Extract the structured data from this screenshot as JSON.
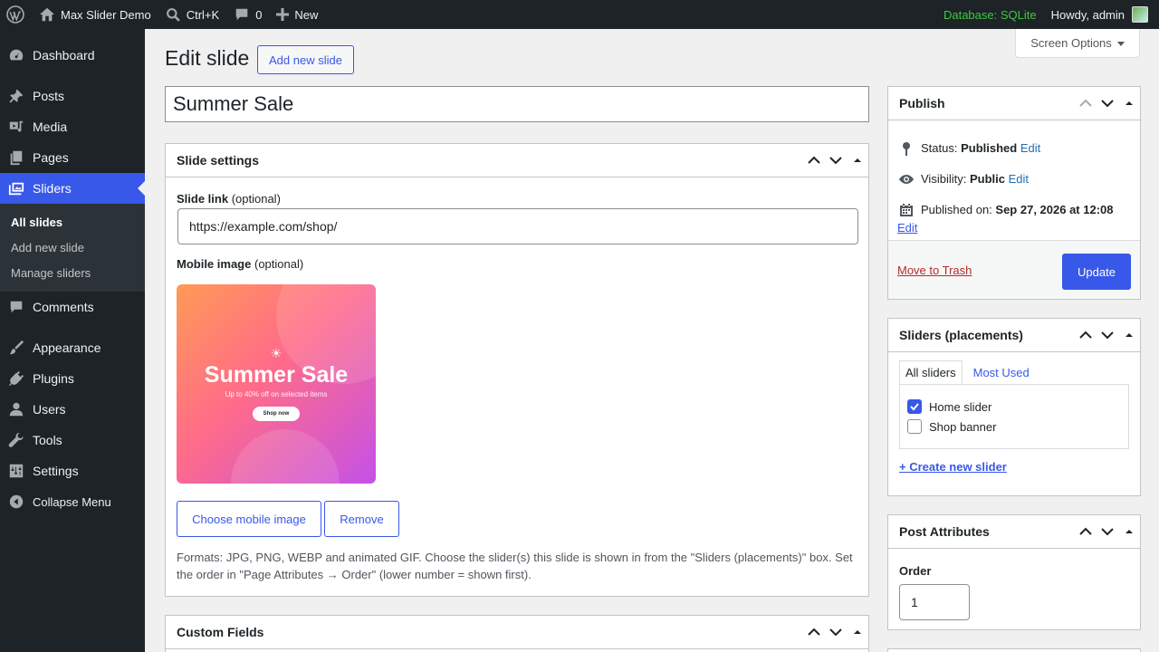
{
  "adminbar": {
    "site_name": "Max Slider Demo",
    "search_shortcut": "Ctrl+K",
    "comments_count": "0",
    "new_label": "New",
    "db_status": "Database: SQLite",
    "howdy": "Howdy, admin"
  },
  "sidebar": {
    "items": [
      {
        "label": "Dashboard",
        "icon": "dashboard-icon"
      },
      {
        "label": "Posts",
        "icon": "pin-icon"
      },
      {
        "label": "Media",
        "icon": "media-icon"
      },
      {
        "label": "Pages",
        "icon": "pages-icon"
      },
      {
        "label": "Sliders",
        "icon": "slides-icon"
      },
      {
        "label": "Comments",
        "icon": "comment-icon"
      },
      {
        "label": "Appearance",
        "icon": "brush-icon"
      },
      {
        "label": "Plugins",
        "icon": "plugin-icon"
      },
      {
        "label": "Users",
        "icon": "user-icon"
      },
      {
        "label": "Tools",
        "icon": "wrench-icon"
      },
      {
        "label": "Settings",
        "icon": "settings-icon"
      },
      {
        "label": "Collapse Menu",
        "icon": "collapse-icon"
      }
    ],
    "submenu": [
      "All slides",
      "Add new slide",
      "Manage sliders"
    ]
  },
  "header": {
    "screen_options": "Screen Options",
    "title": "Edit slide",
    "add_new": "Add new slide"
  },
  "post": {
    "title": "Summer Sale"
  },
  "slide_settings": {
    "heading": "Slide settings",
    "link_label": "Slide link",
    "link_optional": "(optional)",
    "link_value": "https://example.com/shop/",
    "mobile_label": "Mobile image",
    "mobile_optional": "(optional)",
    "preview": {
      "sun": "☀",
      "title": "Summer Sale",
      "subtitle": "Up to 40% off on selected items",
      "button": "Shop now"
    },
    "choose_btn": "Choose mobile image",
    "remove_btn": "Remove",
    "help": "Formats: JPG, PNG, WEBP and animated GIF. Choose the slider(s) this slide is shown in from the \"Sliders (placements)\" box. Set the order in \"Page Attributes → Order\" (lower number = shown first)."
  },
  "custom_fields": {
    "heading": "Custom Fields"
  },
  "publish": {
    "heading": "Publish",
    "status_label": "Status:",
    "status_value": "Published",
    "visibility_label": "Visibility:",
    "visibility_value": "Public",
    "published_label": "Published on:",
    "published_value": "Sep 27, 2026 at 12:08",
    "edit": "Edit",
    "trash": "Move to Trash",
    "update": "Update"
  },
  "sliders_box": {
    "heading": "Sliders (placements)",
    "tab_all": "All sliders",
    "tab_most": "Most Used",
    "options": [
      {
        "label": "Home slider",
        "checked": true
      },
      {
        "label": "Shop banner",
        "checked": false
      }
    ],
    "create": "+ Create new slider"
  },
  "attributes": {
    "heading": "Post Attributes",
    "order_label": "Order",
    "order_value": "1"
  },
  "colors": {
    "accent": "#3858e9",
    "adminbar": "#1d2327",
    "db_status": "#3ec93e",
    "danger": "#b32d2e"
  }
}
